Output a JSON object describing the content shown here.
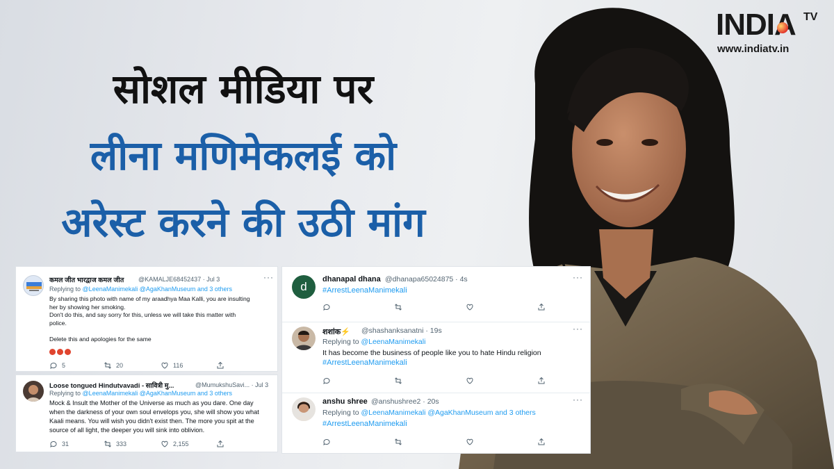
{
  "logo": {
    "brand": "INDIA",
    "brand_suffix": "TV",
    "url": "www.indiatv.in"
  },
  "headline": {
    "line1": "सोशल मीडिया पर",
    "line2": "लीना मणिमेकलई को",
    "line3": "अरेस्ट करने की उठी मांग"
  },
  "colors": {
    "headline_black": "#111111",
    "headline_blue": "#1b5fa8",
    "twitter_blue": "#1d9bf0",
    "muted": "#536471"
  },
  "tweets_left": [
    {
      "name": "कमल जीत भारद्वाज कमल जीत",
      "handle_time": "@KAMALJE68452437 · Jul 3",
      "replying_prefix": "Replying to",
      "replying_to": "@LeenaManimekali @AgaKhanMuseum and 3 others",
      "text_lines": [
        "By sharing this photo with name of my araadhya Maa Kalli, you are insulting",
        "her by showing her smoking.",
        "Don't do this,  and say sorry for this, unless we will take this matter with",
        "police.",
        "",
        "Delete this and apologies for the same"
      ],
      "emoji": [
        "angry-face-icon",
        "angry-face-icon",
        "angry-face-icon"
      ],
      "replies": "5",
      "retweets": "20",
      "likes": "116"
    },
    {
      "name": "Loose tongued Hindutvavadi - सावित्री मु...",
      "handle_time": "@MumukshuSavi... · Jul 3",
      "replying_prefix": "Replying to",
      "replying_to": "@LeenaManimekali @AgaKhanMuseum and 3 others",
      "text_lines": [
        "Mock & Insult the Mother of the Universe as much as you dare. One day",
        "when the darkness of your own soul envelops you, she will show you what",
        "Kaali means. You will wish you didn't exist then. The more you spit at the",
        "source of all light, the deeper you will sink into oblivion."
      ],
      "replies": "31",
      "retweets": "333",
      "likes": "2,155"
    }
  ],
  "tweets_right": [
    {
      "avatar_letter": "d",
      "name": "dhanapal dhana",
      "handle_time": "@dhanapa65024875 · 4s",
      "hashtag": "#ArrestLeenaManimekali"
    },
    {
      "name": "शशांक⚡",
      "handle_time": "@shashanksanatni · 19s",
      "replying_prefix": "Replying to",
      "replying_to": "@LeenaManimekali",
      "text": "It has become the business of people like you to hate Hindu religion",
      "hashtag": "#ArrestLeenaManimekali"
    },
    {
      "name": "anshu shree",
      "handle_time": "@anshushree2 · 20s",
      "replying_prefix": "Replying to",
      "replying_to": "@LeenaManimekali @AgaKhanMuseum and 3 others",
      "hashtag": "#ArrestLeenaManimekali"
    }
  ],
  "ui": {
    "more": "···"
  }
}
